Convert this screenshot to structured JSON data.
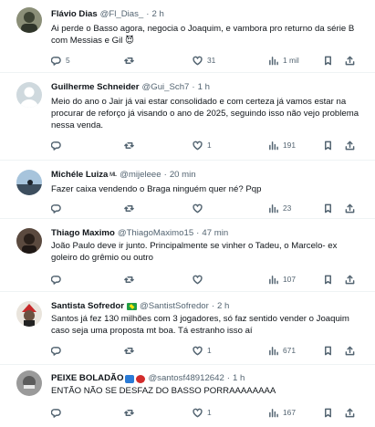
{
  "tweets": [
    {
      "name": "Flávio Dias",
      "handle": "@Fl_Dias_",
      "time": "2 h",
      "name_emoji": "",
      "text": "Ai perde o Basso agora, negocia o Joaquim, e vambora pro returno da série B com Messias e Gil 😈",
      "replies": "5",
      "retweets": "",
      "likes": "31",
      "views": "1 mil"
    },
    {
      "name": "Guilherme Schneider",
      "handle": "@Gui_Sch7",
      "time": "1 h",
      "name_emoji": "",
      "text": "Meio do ano o Jair já vai estar consolidado e com certeza já vamos estar na procurar de reforço já visando o ano de 2025, seguindo isso não vejo problema nessa venda.",
      "replies": "",
      "retweets": "",
      "likes": "1",
      "views": "191"
    },
    {
      "name": "Michéle Luiza",
      "handle": "@mijeleee",
      "time": "20 min",
      "name_emoji": "ᴹᴸ",
      "text": "Fazer caixa vendendo o Braga ninguém quer né? Pqp",
      "replies": "",
      "retweets": "",
      "likes": "",
      "views": "23"
    },
    {
      "name": "Thiago Maximo",
      "handle": "@ThiagoMaximo15",
      "time": "47 min",
      "name_emoji": "",
      "text": "João Paulo deve ir junto.  Principalmente se vinher o Tadeu,  o Marcelo- ex goleiro do grêmio ou outro",
      "replies": "",
      "retweets": "",
      "likes": "",
      "views": "107"
    },
    {
      "name": "Santista Sofredor",
      "handle": "@SantistSofredor",
      "time": "2 h",
      "name_emoji": "",
      "text": "Santos já fez 130 milhões com 3 jogadores, só faz sentido vender o Joaquim caso seja uma proposta mt boa. Tá estranho isso aí",
      "replies": "",
      "retweets": "",
      "likes": "1",
      "views": "671"
    },
    {
      "name": "PEIXE BOLADÃO",
      "handle": "@santosf48912642",
      "time": "1 h",
      "name_emoji": "",
      "text": "ENTÃO NÃO SE DESFAZ DO BASSO PORRAAAAAAAA",
      "replies": "",
      "retweets": "",
      "likes": "1",
      "views": "167"
    }
  ],
  "colors": {
    "text": "#0f1419",
    "secondary": "#536471",
    "divider": "#eff3f4"
  },
  "icons": [
    "reply-icon",
    "retweet-icon",
    "like-icon",
    "views-icon",
    "bookmark-icon",
    "share-icon"
  ]
}
